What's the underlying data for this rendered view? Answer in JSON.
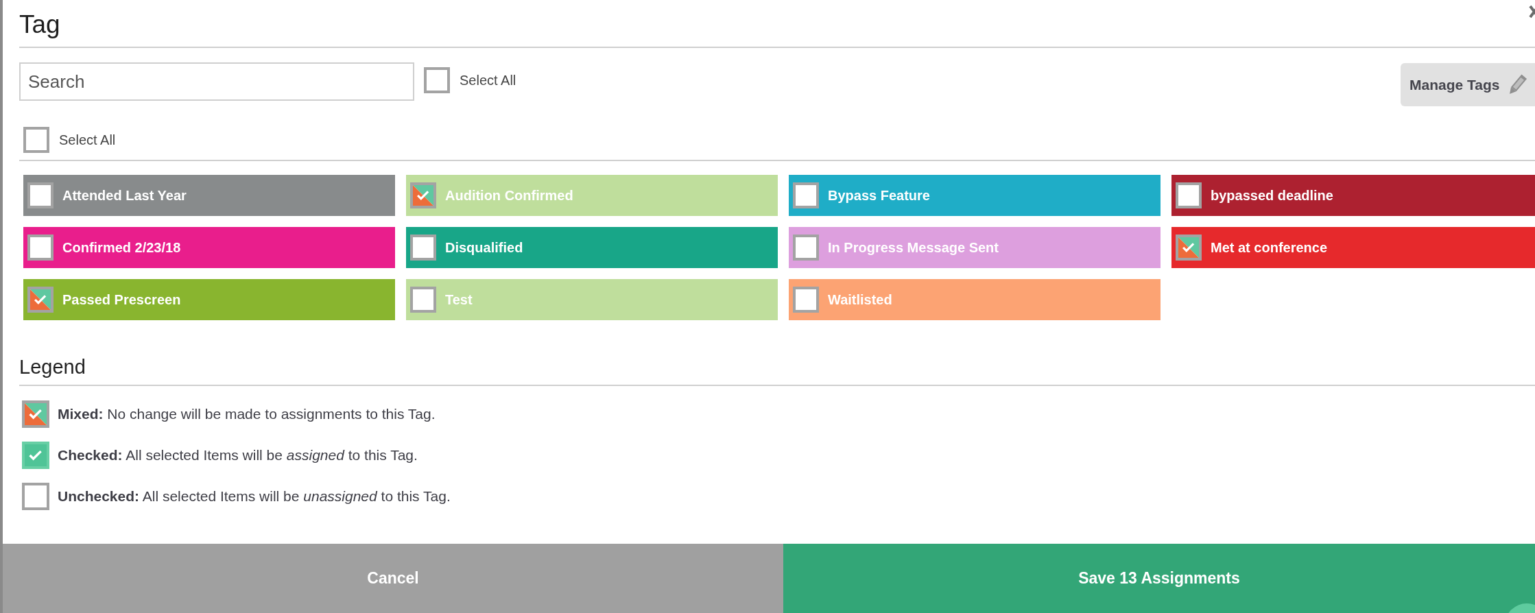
{
  "dialog": {
    "title": "Tag"
  },
  "search": {
    "placeholder": "Search"
  },
  "select_all_top": {
    "label": "Select All",
    "checked": false
  },
  "manage_tags_button": {
    "label": "Manage Tags"
  },
  "select_all": {
    "label": "Select All",
    "checked": false
  },
  "tags": [
    {
      "label": "Attended Last Year",
      "color": "#888b8c",
      "mixed": false
    },
    {
      "label": "Audition Confirmed",
      "color": "#bfde9c",
      "mixed": true
    },
    {
      "label": "Bypass Feature",
      "color": "#1fadc7",
      "mixed": false
    },
    {
      "label": "bypassed deadline",
      "color": "#ad2130",
      "mixed": false
    },
    {
      "label": "Confirmed 2/23/18",
      "color": "#e91e8c",
      "mixed": false
    },
    {
      "label": "Disqualified",
      "color": "#18a688",
      "mixed": false
    },
    {
      "label": "In Progress Message Sent",
      "color": "#dd9fde",
      "mixed": false
    },
    {
      "label": "Met at conference",
      "color": "#e6292c",
      "mixed": true
    },
    {
      "label": "Passed Prescreen",
      "color": "#89b52f",
      "mixed": true
    },
    {
      "label": "Test",
      "color": "#bfde9c",
      "mixed": false
    },
    {
      "label": "Waitlisted",
      "color": "#fca373",
      "mixed": false
    }
  ],
  "legend": {
    "title": "Legend",
    "items": [
      {
        "kind": "mixed",
        "text": "**Mixed:** No change will be made to assignments to this Tag."
      },
      {
        "kind": "checked",
        "text": "**Checked:** All selected Items will be *assigned* to this Tag."
      },
      {
        "kind": "unchecked",
        "text": "**Unchecked:** All selected Items will be *unassigned* to this Tag."
      }
    ]
  },
  "footer": {
    "cancel": "Cancel",
    "save": "Save 13 Assignments"
  }
}
